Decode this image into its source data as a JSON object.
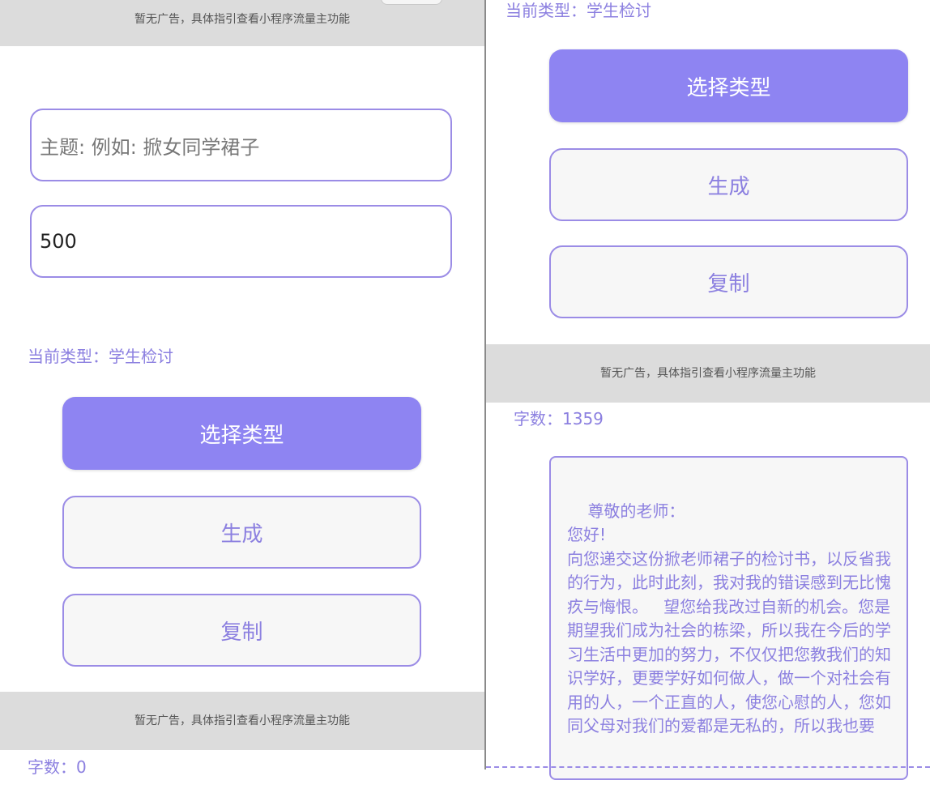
{
  "ad_text": "暂无广告，具体指引查看小程序流量主功能",
  "left": {
    "topic_placeholder": "主题: 例如: 掀女同学裙子",
    "word_limit_value": "500",
    "current_type": "当前类型：学生检讨",
    "select_type_label": "选择类型",
    "generate_label": "生成",
    "copy_label": "复制",
    "word_count": "字数：0"
  },
  "right": {
    "current_type": "当前类型：学生检讨",
    "select_type_label": "选择类型",
    "generate_label": "生成",
    "copy_label": "复制",
    "word_count": "字数：1359",
    "result_text": "尊敬的老师：\n您好!\n向您递交这份掀老师裙子的检讨书，以反省我的行为，此时此刻，我对我的错误感到无比愧疚与悔恨。   望您给我改过自新的机会。您是期望我们成为社会的栋梁，所以我在今后的学习生活中更加的努力，不仅仅把您教我们的知识学好，更要学好如何做人，做一个对社会有用的人，一个正直的人，使您心慰的人，您如同父母对我们的爱都是无私的，所以我也要"
  },
  "colors": {
    "accent": "#8e84f2",
    "border": "#9b8ce6",
    "text_accent": "#8c80e0",
    "ad_bg": "#dcdcdc"
  }
}
